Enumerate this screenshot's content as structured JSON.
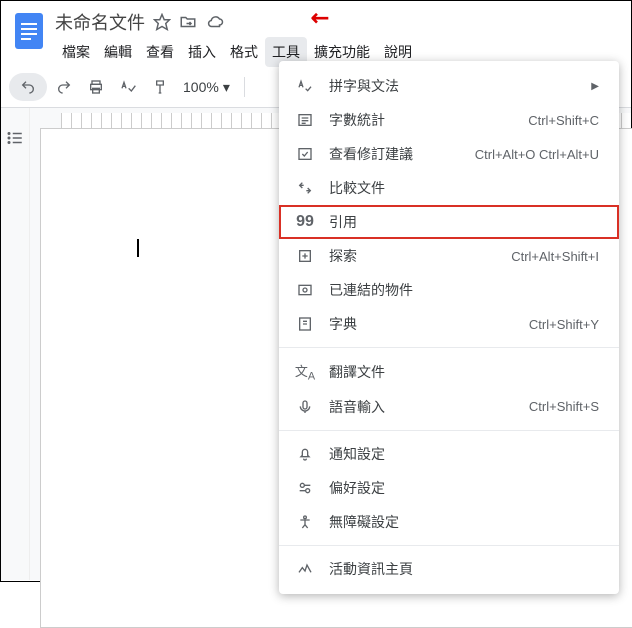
{
  "doc": {
    "title": "未命名文件"
  },
  "menubar": [
    "檔案",
    "編輯",
    "查看",
    "插入",
    "格式",
    "工具",
    "擴充功能",
    "說明"
  ],
  "toolbar": {
    "zoom": "100%"
  },
  "menu": {
    "items": [
      {
        "icon": "spellcheck",
        "label": "拼字與文法",
        "shortcut": "",
        "arrow": true
      },
      {
        "icon": "wordcount",
        "label": "字數統計",
        "shortcut": "Ctrl+Shift+C"
      },
      {
        "icon": "suggest",
        "label": "查看修訂建議",
        "shortcut": "Ctrl+Alt+O Ctrl+Alt+U"
      },
      {
        "icon": "compare",
        "label": "比較文件",
        "shortcut": ""
      },
      {
        "icon": "quote",
        "label": "引用",
        "shortcut": "",
        "highlight": true
      },
      {
        "icon": "explore",
        "label": "探索",
        "shortcut": "Ctrl+Alt+Shift+I"
      },
      {
        "icon": "linked",
        "label": "已連結的物件",
        "shortcut": ""
      },
      {
        "icon": "dict",
        "label": "字典",
        "shortcut": "Ctrl+Shift+Y"
      },
      {
        "sep": true
      },
      {
        "icon": "translate",
        "label": "翻譯文件",
        "shortcut": ""
      },
      {
        "icon": "voice",
        "label": "語音輸入",
        "shortcut": "Ctrl+Shift+S"
      },
      {
        "sep": true
      },
      {
        "icon": "bell",
        "label": "通知設定",
        "shortcut": ""
      },
      {
        "icon": "prefs",
        "label": "偏好設定",
        "shortcut": ""
      },
      {
        "icon": "a11y",
        "label": "無障礙設定",
        "shortcut": ""
      },
      {
        "sep": true
      },
      {
        "icon": "activity",
        "label": "活動資訊主頁",
        "shortcut": ""
      }
    ]
  }
}
